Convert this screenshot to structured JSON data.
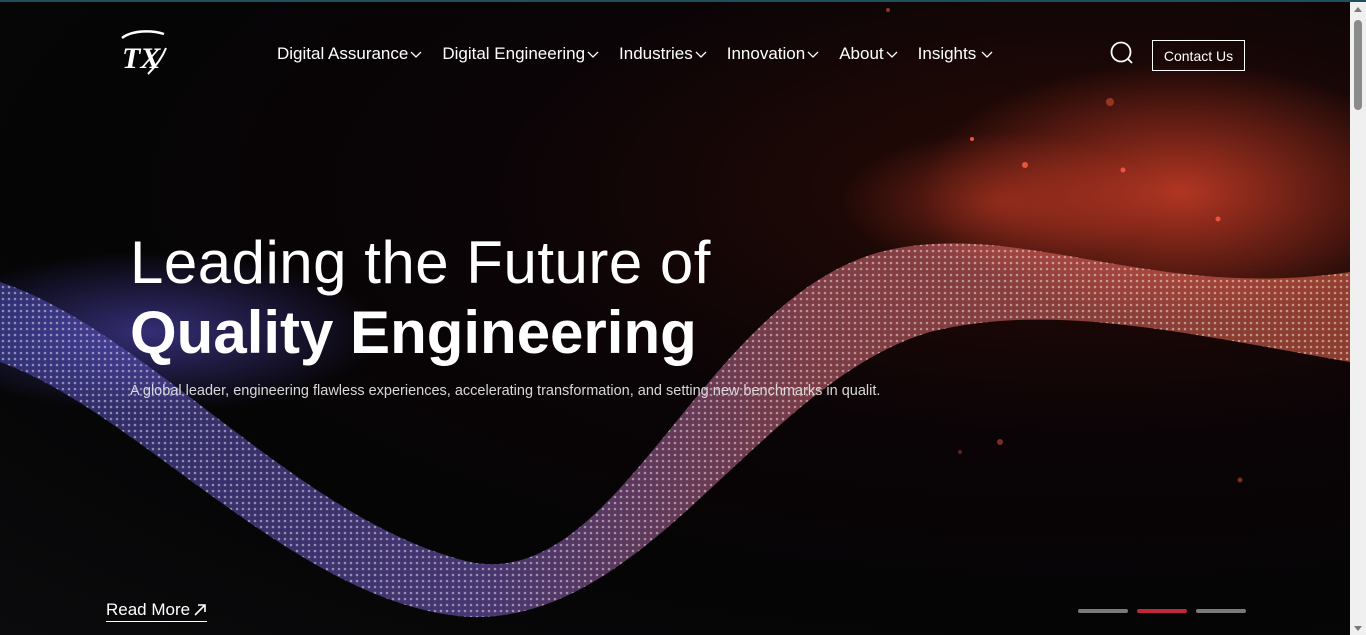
{
  "header": {
    "logo_text": "TX",
    "nav": [
      {
        "label": "Digital Assurance"
      },
      {
        "label": "Digital Engineering"
      },
      {
        "label": "Industries"
      },
      {
        "label": "Innovation"
      },
      {
        "label": "About"
      },
      {
        "label": "Insights"
      }
    ],
    "contact_label": "Contact Us"
  },
  "hero": {
    "line1": "Leading the Future of",
    "line2": "Quality Engineering",
    "subtitle": "A global leader, engineering flawless experiences, accelerating transformation, and setting new benchmarks in qualit.",
    "read_more": "Read More"
  },
  "carousel": {
    "slides": 3,
    "active_index": 1
  },
  "colors": {
    "accent": "#c0283a",
    "background": "#050506",
    "wave_red": "#e85a48",
    "wave_purple": "#6e5fd6"
  }
}
